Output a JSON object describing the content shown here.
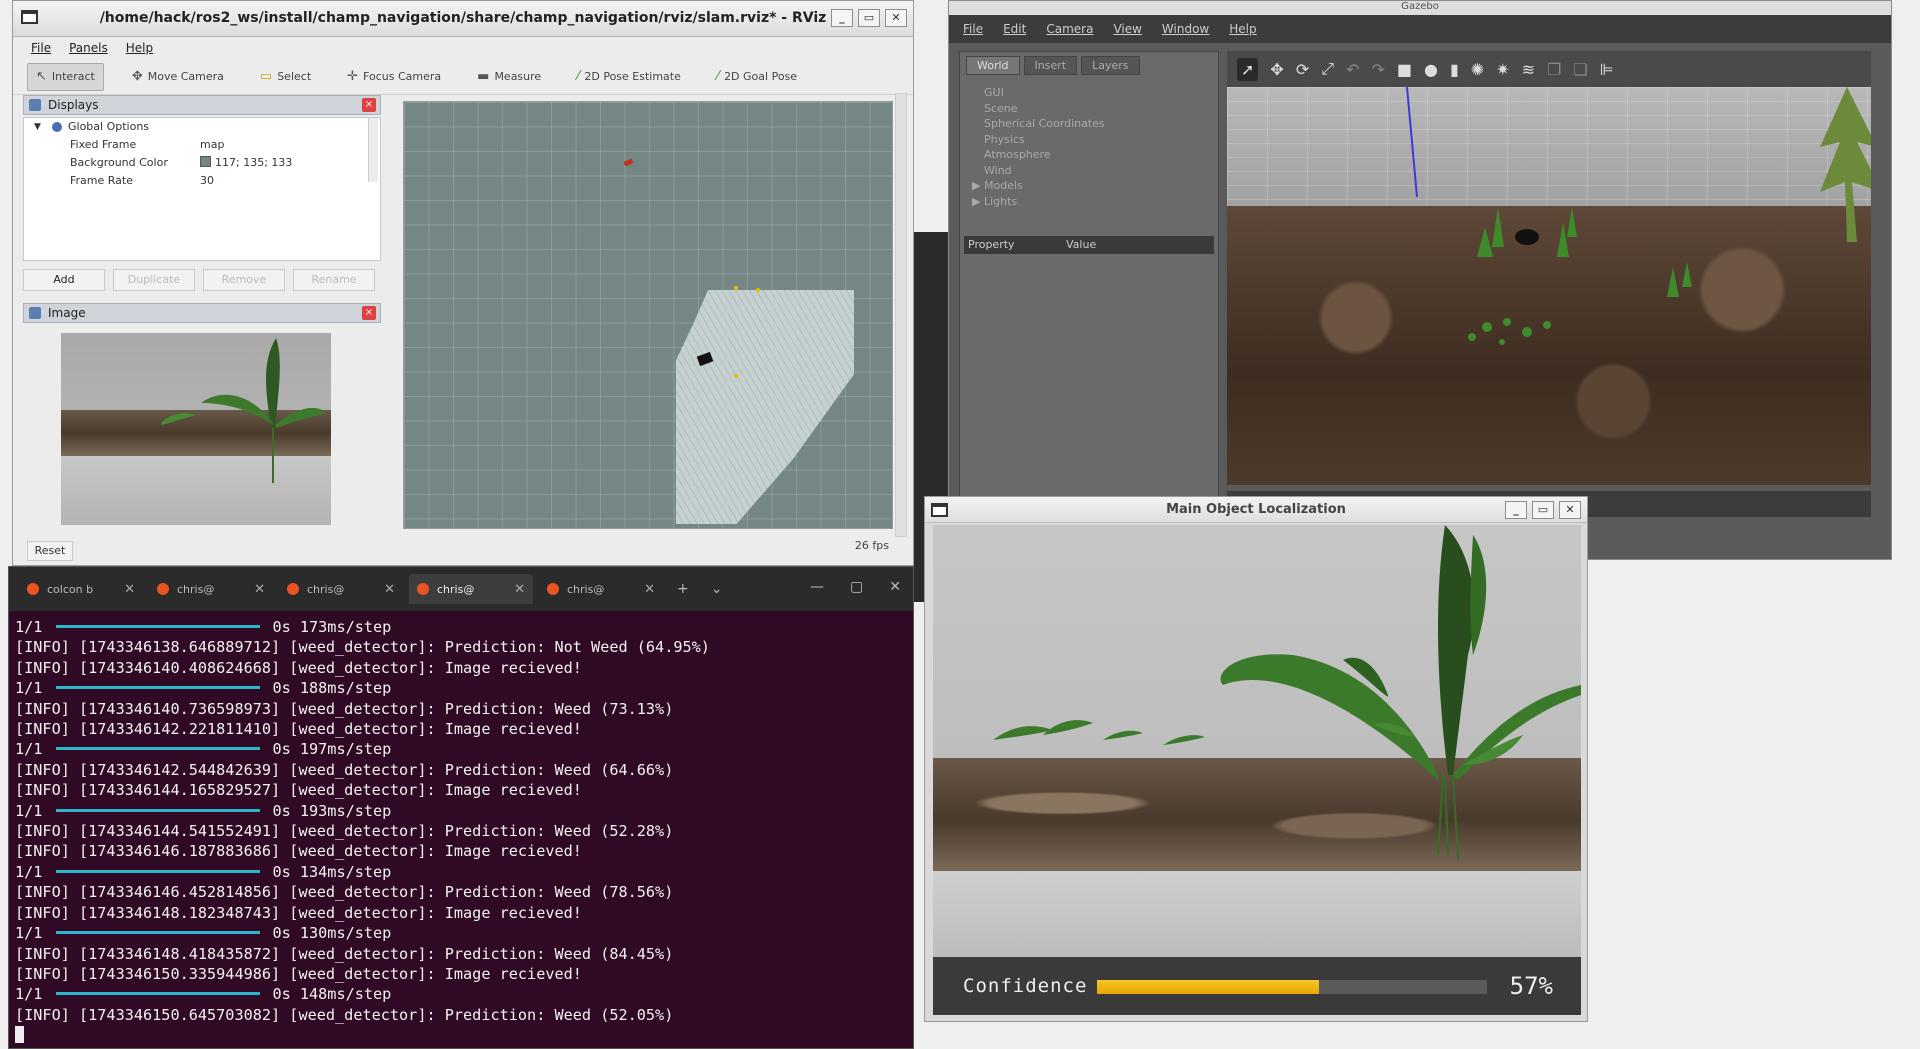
{
  "rviz": {
    "title": "/home/hack/ros2_ws/install/champ_navigation/share/champ_navigation/rviz/slam.rviz* - RViz",
    "menu": [
      "File",
      "Panels",
      "Help"
    ],
    "tools": [
      {
        "icon": "interact-icon",
        "label": "Interact"
      },
      {
        "icon": "move-camera-icon",
        "label": "Move Camera"
      },
      {
        "icon": "select-icon",
        "label": "Select"
      },
      {
        "icon": "focus-camera-icon",
        "label": "Focus Camera"
      },
      {
        "icon": "measure-icon",
        "label": "Measure"
      },
      {
        "icon": "pose-estimate-icon",
        "label": "2D Pose Estimate"
      },
      {
        "icon": "goal-pose-icon",
        "label": "2D Goal Pose"
      }
    ],
    "displays_title": "Displays",
    "global_options": "Global Options",
    "props": [
      {
        "key": "Fixed Frame",
        "value": "map"
      },
      {
        "key": "Background Color",
        "value": "117; 135; 133"
      },
      {
        "key": "Frame Rate",
        "value": "30"
      }
    ],
    "buttons": [
      "Add",
      "Duplicate",
      "Remove",
      "Rename"
    ],
    "image_title": "Image",
    "reset": "Reset",
    "fps": "26 fps",
    "background_color": "#758785"
  },
  "gazebo": {
    "title": "Gazebo",
    "menu": [
      "File",
      "Edit",
      "Camera",
      "View",
      "Window",
      "Help"
    ],
    "tabs": [
      "World",
      "Insert",
      "Layers"
    ],
    "tree": [
      "GUI",
      "Scene",
      "Spherical Coordinates",
      "Physics",
      "Atmosphere",
      "Wind",
      "Models",
      "Lights"
    ],
    "prop_header": [
      "Property",
      "Value"
    ]
  },
  "localization": {
    "title": "Main Object Localization",
    "confidence_label": "Confidence",
    "confidence_value": 0.57,
    "confidence_text": "57%"
  },
  "terminal": {
    "tabs": [
      "colcon b",
      "chris@",
      "chris@",
      "chris@",
      "chris@"
    ],
    "active_tab": 3,
    "lines": [
      {
        "type": "step",
        "prefix": "1/1",
        "suffix": "0s 173ms/step"
      },
      {
        "type": "text",
        "text": "[INFO] [1743346138.646889712] [weed_detector]: Prediction: Not Weed (64.95%)"
      },
      {
        "type": "text",
        "text": "[INFO] [1743346140.408624668] [weed_detector]: Image recieved!"
      },
      {
        "type": "step",
        "prefix": "1/1",
        "suffix": "0s 188ms/step"
      },
      {
        "type": "text",
        "text": "[INFO] [1743346140.736598973] [weed_detector]: Prediction: Weed (73.13%)"
      },
      {
        "type": "text",
        "text": "[INFO] [1743346142.221811410] [weed_detector]: Image recieved!"
      },
      {
        "type": "step",
        "prefix": "1/1",
        "suffix": "0s 197ms/step"
      },
      {
        "type": "text",
        "text": "[INFO] [1743346142.544842639] [weed_detector]: Prediction: Weed (64.66%)"
      },
      {
        "type": "text",
        "text": "[INFO] [1743346144.165829527] [weed_detector]: Image recieved!"
      },
      {
        "type": "step",
        "prefix": "1/1",
        "suffix": "0s 193ms/step"
      },
      {
        "type": "text",
        "text": "[INFO] [1743346144.541552491] [weed_detector]: Prediction: Weed (52.28%)"
      },
      {
        "type": "text",
        "text": "[INFO] [1743346146.187883686] [weed_detector]: Image recieved!"
      },
      {
        "type": "step",
        "prefix": "1/1",
        "suffix": "0s 134ms/step"
      },
      {
        "type": "text",
        "text": "[INFO] [1743346146.452814856] [weed_detector]: Prediction: Weed (78.56%)"
      },
      {
        "type": "text",
        "text": "[INFO] [1743346148.182348743] [weed_detector]: Image recieved!"
      },
      {
        "type": "step",
        "prefix": "1/1",
        "suffix": "0s 130ms/step"
      },
      {
        "type": "text",
        "text": "[INFO] [1743346148.418435872] [weed_detector]: Prediction: Weed (84.45%)"
      },
      {
        "type": "text",
        "text": "[INFO] [1743346150.335944986] [weed_detector]: Image recieved!"
      },
      {
        "type": "step",
        "prefix": "1/1",
        "suffix": "0s 148ms/step"
      },
      {
        "type": "text",
        "text": "[INFO] [1743346150.645703082] [weed_detector]: Prediction: Weed (52.05%)"
      }
    ]
  }
}
